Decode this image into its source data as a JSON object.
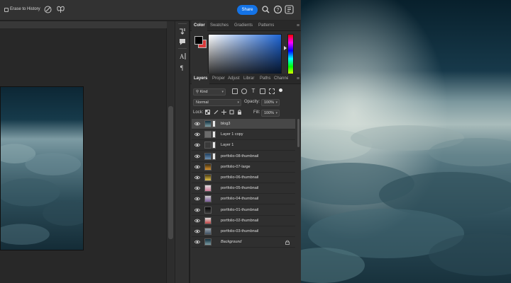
{
  "options_bar": {
    "erase_to_history_label": "Erase to History",
    "share_label": "Share",
    "icons": [
      "pressure-pen-icon",
      "butterfly-icon",
      "search-icon",
      "help-icon",
      "account-icon"
    ]
  },
  "color_panel": {
    "tabs": [
      "Color",
      "Swatches",
      "Gradients",
      "Patterns"
    ],
    "active_tab": "Color",
    "foreground_color": "#000000",
    "background_color": "#d83b3b",
    "picker_hue": "#1f66d6"
  },
  "layers_panel": {
    "tabs": [
      "Layers",
      "Proper",
      "Adjust",
      "Librar",
      "Paths",
      "Channe"
    ],
    "active_tab": "Layers",
    "kind_filter": "Kind",
    "blend_mode": "Normal",
    "opacity_label": "Opacity:",
    "opacity_value": "100%",
    "lock_label": "Lock:",
    "fill_label": "Fill:",
    "fill_value": "100%",
    "layers": [
      {
        "name": "blog3",
        "selected": true,
        "italic": false,
        "thumb": "sky"
      },
      {
        "name": "Layer 1 copy",
        "selected": false,
        "italic": false,
        "thumb": "gray"
      },
      {
        "name": "Layer 1",
        "selected": false,
        "italic": false,
        "thumb": "dark"
      },
      {
        "name": "portfolio-08-thumbnail",
        "selected": false,
        "italic": false,
        "thumb": "blue"
      },
      {
        "name": "portfolio-07-large",
        "selected": false,
        "italic": false,
        "thumb": "orange"
      },
      {
        "name": "portfolio-06-thumbnail",
        "selected": false,
        "italic": false,
        "thumb": "yellow"
      },
      {
        "name": "portfolio-05-thumbnail",
        "selected": false,
        "italic": false,
        "thumb": "pink"
      },
      {
        "name": "portfolio-04-thumbnail",
        "selected": false,
        "italic": false,
        "thumb": "purple"
      },
      {
        "name": "portfolio-01-thumbnail",
        "selected": false,
        "italic": false,
        "thumb": "night"
      },
      {
        "name": "portfolio-02-thumbnail",
        "selected": false,
        "italic": false,
        "thumb": "red"
      },
      {
        "name": "portfolio-03-thumbnail",
        "selected": false,
        "italic": false,
        "thumb": "steel"
      },
      {
        "name": "Background",
        "selected": false,
        "italic": true,
        "thumb": "sky",
        "locked": true
      }
    ]
  }
}
